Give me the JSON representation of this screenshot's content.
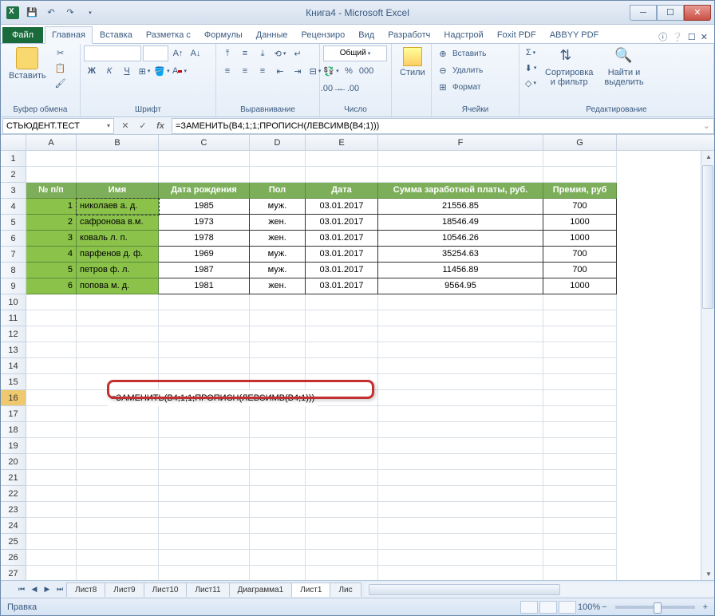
{
  "title": "Книга4 - Microsoft Excel",
  "namebox": "СТЬЮДЕНТ.ТЕСТ",
  "formula": "=ЗАМЕНИТЬ(B4;1;1;ПРОПИСН(ЛЕВСИМВ(B4;1)))",
  "tabs": {
    "file": "Файл",
    "home": "Главная",
    "insert": "Вставка",
    "layout": "Разметка с",
    "formulas": "Формулы",
    "data": "Данные",
    "review": "Рецензиро",
    "view": "Вид",
    "dev": "Разработч",
    "addins": "Надстрой",
    "foxit": "Foxit PDF",
    "abbyy": "ABBYY PDF"
  },
  "groups": {
    "clipboard": "Буфер обмена",
    "font": "Шрифт",
    "alignment": "Выравнивание",
    "number": "Число",
    "styles": "Стили",
    "cells": "Ячейки",
    "editing": "Редактирование"
  },
  "ribbon": {
    "paste": "Вставить",
    "number_fmt": "Общий",
    "styles": "Стили",
    "insert_cell": "Вставить",
    "delete_cell": "Удалить",
    "format_cell": "Формат",
    "sort": "Сортировка\nи фильтр",
    "find": "Найти и\nвыделить"
  },
  "cols": {
    "a": "A",
    "b": "B",
    "c": "C",
    "d": "D",
    "e": "E",
    "f": "F",
    "g": "G"
  },
  "headers": {
    "num": "№ п/п",
    "name": "Имя",
    "dob": "Дата рождения",
    "gender": "Пол",
    "date": "Дата",
    "salary": "Сумма заработной платы, руб.",
    "bonus": "Премия, руб"
  },
  "rows": [
    {
      "n": "1",
      "name": "николаев а. д.",
      "dob": "1985",
      "g": "муж.",
      "d": "03.01.2017",
      "s": "21556.85",
      "b": "700"
    },
    {
      "n": "2",
      "name": "сафронова в.м.",
      "dob": "1973",
      "g": "жен.",
      "d": "03.01.2017",
      "s": "18546.49",
      "b": "1000"
    },
    {
      "n": "3",
      "name": "коваль л. п.",
      "dob": "1978",
      "g": "жен.",
      "d": "03.01.2017",
      "s": "10546.26",
      "b": "1000"
    },
    {
      "n": "4",
      "name": "парфенов д. ф.",
      "dob": "1969",
      "g": "муж.",
      "d": "03.01.2017",
      "s": "35254.63",
      "b": "700"
    },
    {
      "n": "5",
      "name": "петров ф. л.",
      "dob": "1987",
      "g": "муж.",
      "d": "03.01.2017",
      "s": "11456.89",
      "b": "700"
    },
    {
      "n": "6",
      "name": "попова м. д.",
      "dob": "1981",
      "g": "жен.",
      "d": "03.01.2017",
      "s": "9564.95",
      "b": "1000"
    }
  ],
  "cell_formula": "=ЗАМЕНИТЬ(B4;1;1;ПРОПИСН(ЛЕВСИМВ(B4;1)))",
  "sheets": {
    "s8": "Лист8",
    "s9": "Лист9",
    "s10": "Лист10",
    "s11": "Лист11",
    "diag": "Диаграмма1",
    "s1": "Лист1",
    "s2": "Лис"
  },
  "status": "Правка",
  "zoom": "100%"
}
